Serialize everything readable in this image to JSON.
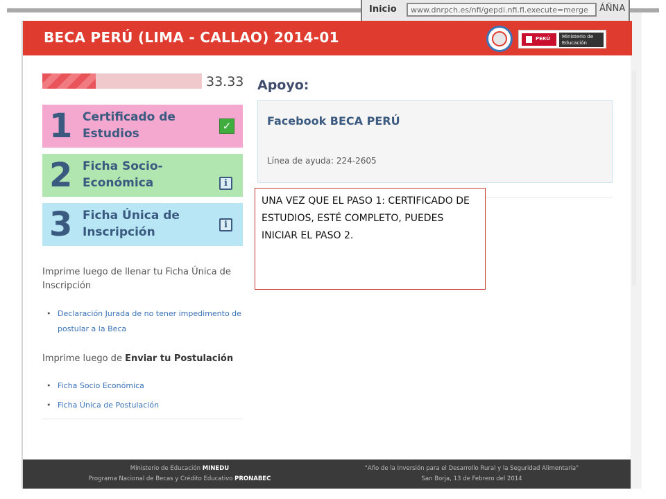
{
  "browser": {
    "tab_label": "Inicio",
    "url_text": "www.dnrpch.es/nfi/gepdi.nfi.fl.execute=merge",
    "tab_tail": "ÁÑNA"
  },
  "header": {
    "title": "BECA PERÚ (LIMA - CALLAO) 2014-01",
    "peru_label": "PERÚ",
    "ministerio_label": "Ministerio de Educación"
  },
  "progress": {
    "value_text": "33.33",
    "fraction": 0.3333
  },
  "steps": [
    {
      "number": "1",
      "label": "Certificado de Estudios",
      "status_icon": "check-icon"
    },
    {
      "number": "2",
      "label": "Ficha Socio-Económica",
      "status_icon": "info-icon"
    },
    {
      "number": "3",
      "label": "Ficha Única de Inscripción",
      "status_icon": "info-icon"
    }
  ],
  "print_section_1": {
    "heading": "Imprime luego de llenar tu Ficha Única de Inscripción",
    "links": [
      "Declaración Jurada de no tener impedimento de postular a la Beca"
    ]
  },
  "print_section_2": {
    "heading_prefix": "Imprime luego de ",
    "heading_bold": "Enviar tu Postulación",
    "links": [
      "Ficha Socio Económica",
      "Ficha Única de Postulación"
    ]
  },
  "apoyo": {
    "title": "Apoyo:",
    "facebook_label": "Facebook BECA PERÚ",
    "help_line": "Línea de ayuda: 224-2605"
  },
  "callout": {
    "text": "UNA VEZ QUE EL PASO 1: CERTIFICADO DE ESTUDIOS, ESTÉ COMPLETO, PUEDES INICIAR EL PASO 2."
  },
  "footer": {
    "left_line1_prefix": "Ministerio de Educación ",
    "left_line1_bold": "MINEDU",
    "left_line2_prefix": "Programa Nacional de Becas y Crédito Educativo ",
    "left_line2_bold": "PRONABEC",
    "right_line1": "\"Año de la Inversión para el Desarrollo Rural y la Seguridad Alimentaria\"",
    "right_line2": "San Borja, 13 de Febrero del 2014"
  },
  "colors": {
    "header_red": "#e03b2f",
    "step1_pink": "#f4a8cf",
    "step2_green": "#b1e6b1",
    "step3_blue": "#b8e6f5",
    "step_text_navy": "#3a5a80",
    "link_blue": "#3b73b9",
    "footer_dark": "#3a3a3a"
  }
}
